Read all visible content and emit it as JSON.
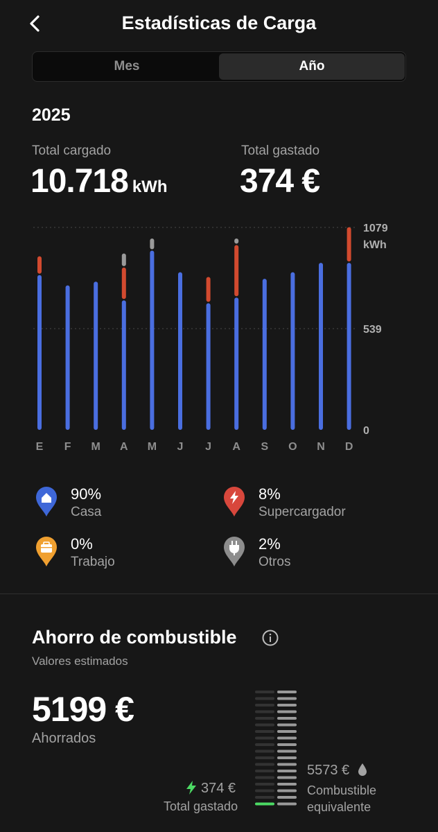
{
  "header": {
    "title": "Estadísticas de Carga",
    "back_icon": "chevron-left-icon"
  },
  "tabs": [
    {
      "label": "Mes",
      "selected": false
    },
    {
      "label": "Año",
      "selected": true
    }
  ],
  "period": {
    "year": "2025"
  },
  "totals": {
    "charged_label": "Total cargado",
    "charged_value": "10.718",
    "charged_unit": "kWh",
    "spent_label": "Total gastado",
    "spent_value": "374 €"
  },
  "chart_data": {
    "type": "bar",
    "stacked": true,
    "categories": [
      "E",
      "F",
      "M",
      "A",
      "M",
      "J",
      "J",
      "A",
      "S",
      "O",
      "N",
      "D"
    ],
    "series": [
      {
        "name": "Casa",
        "color": "#4a6ee0",
        "values": [
          825,
          770,
          790,
          690,
          955,
          840,
          675,
          705,
          805,
          840,
          890,
          890
        ]
      },
      {
        "name": "Supercargador",
        "color": "#d24a2f",
        "values": [
          100,
          0,
          0,
          175,
          0,
          0,
          140,
          280,
          0,
          0,
          0,
          190
        ]
      },
      {
        "name": "Otros",
        "color": "#9a9a9a",
        "values": [
          0,
          0,
          0,
          75,
          65,
          0,
          0,
          35,
          0,
          0,
          0,
          0
        ]
      }
    ],
    "y_ticks": [
      "0",
      "539",
      "1079"
    ],
    "y_unit": "kWh",
    "ylim": [
      0,
      1079
    ],
    "grid": "dashed at 539 and 1079",
    "axis_position": "right"
  },
  "legend": [
    {
      "id": "casa",
      "pct": "90%",
      "name": "Casa",
      "icon": "home-icon",
      "color": "#3e67d8"
    },
    {
      "id": "supercargador",
      "pct": "8%",
      "name": "Supercargador",
      "icon": "lightning-icon",
      "color": "#d8473c"
    },
    {
      "id": "trabajo",
      "pct": "0%",
      "name": "Trabajo",
      "icon": "briefcase-icon",
      "color": "#f0a030"
    },
    {
      "id": "otros",
      "pct": "2%",
      "name": "Otros",
      "icon": "plug-icon",
      "color": "#8d8d8d"
    }
  ],
  "fuel": {
    "title": "Ahorro de combustible",
    "info_icon": "info-icon",
    "subtitle": "Valores estimados",
    "saved_value": "5199 €",
    "saved_label": "Ahorrados",
    "spent_value": "374 €",
    "spent_label": "Total gastado",
    "spent_icon": "lightning-icon",
    "spent_color": "#4cd964",
    "fuel_value": "5573 €",
    "fuel_icon": "drop-icon",
    "fuel_label_1": "Combustible",
    "fuel_label_2": "equivalente"
  }
}
